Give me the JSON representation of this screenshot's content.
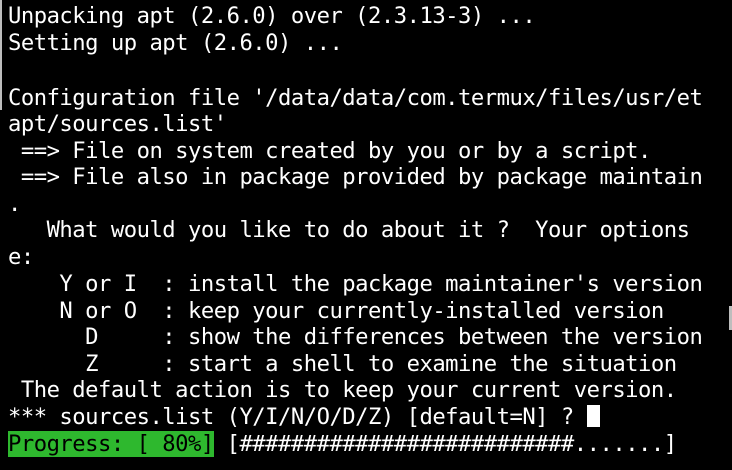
{
  "terminal": {
    "lines": [
      "Unpacking apt (2.6.0) over (2.3.13-3) ...",
      "Setting up apt (2.6.0) ...",
      "",
      "Configuration file '/data/data/com.termux/files/usr/et",
      "apt/sources.list'",
      " ==> File on system created by you or by a script.",
      " ==> File also in package provided by package maintain",
      ".",
      "   What would you like to do about it ?  Your options",
      "e:",
      "    Y or I  : install the package maintainer's version",
      "    N or O  : keep your currently-installed version",
      "      D     : show the differences between the version",
      "      Z     : start a shell to examine the situation",
      " The default action is to keep your current version.",
      "*** sources.list (Y/I/N/O/D/Z) [default=N] ? "
    ],
    "progress": {
      "label": "Progress: [ 80%]",
      "bar": " [##########################.......]",
      "percent": 80
    }
  },
  "colors": {
    "background": "#000000",
    "foreground": "#ffffff",
    "progress_label_bg": "#2eb82e",
    "progress_label_fg": "#000000"
  }
}
